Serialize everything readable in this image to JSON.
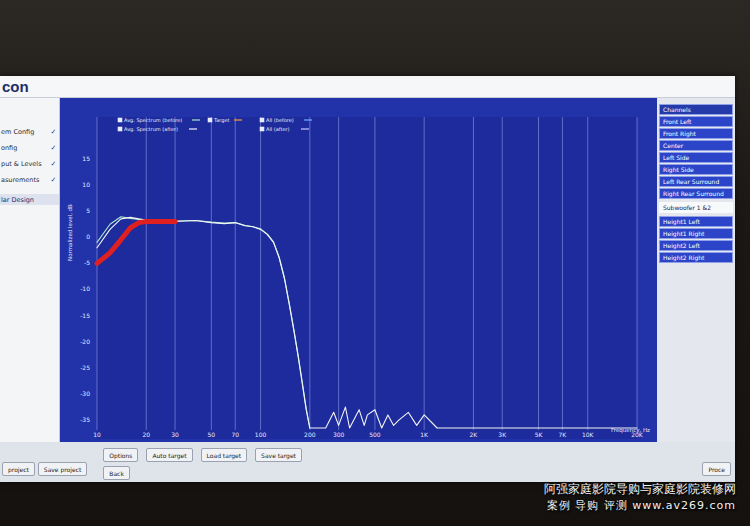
{
  "app": {
    "logo": "con"
  },
  "sidebar": {
    "check_glyph": "✓",
    "items": [
      {
        "label": "em Config",
        "done": true,
        "selected": false
      },
      {
        "label": "onfig",
        "done": true,
        "selected": false
      },
      {
        "label": "put & Levels",
        "done": true,
        "selected": false
      },
      {
        "label": "asurements",
        "done": true,
        "selected": false
      },
      {
        "label": "lar Design",
        "done": false,
        "selected": true
      }
    ]
  },
  "chart": {
    "y_axis_title": "Normalized level, dB",
    "x_axis_title": "Frequency, Hz",
    "y_ticks": [
      {
        "label": "15",
        "value": 15
      },
      {
        "label": "10",
        "value": 10
      },
      {
        "label": "5",
        "value": 5
      },
      {
        "label": "0",
        "value": 0
      },
      {
        "label": "-5",
        "value": -5
      },
      {
        "label": "-10",
        "value": -10
      },
      {
        "label": "-15",
        "value": -15
      },
      {
        "label": "-20",
        "value": -20
      },
      {
        "label": "-25",
        "value": -25
      },
      {
        "label": "-30",
        "value": -30
      },
      {
        "label": "-35",
        "value": -35
      }
    ],
    "x_ticks": [
      {
        "label": "10",
        "value": 10
      },
      {
        "label": "20",
        "value": 20
      },
      {
        "label": "30",
        "value": 30
      },
      {
        "label": "50",
        "value": 50
      },
      {
        "label": "70",
        "value": 70
      },
      {
        "label": "100",
        "value": 100
      },
      {
        "label": "200",
        "value": 200
      },
      {
        "label": "300",
        "value": 300
      },
      {
        "label": "500",
        "value": 500
      },
      {
        "label": "1K",
        "value": 1000
      },
      {
        "label": "2K",
        "value": 2000
      },
      {
        "label": "3K",
        "value": 3000
      },
      {
        "label": "5K",
        "value": 5000
      },
      {
        "label": "7K",
        "value": 7000
      },
      {
        "label": "10K",
        "value": 10000
      },
      {
        "label": "20K",
        "value": 20000
      }
    ],
    "legend": [
      {
        "label": "Avg. Spectrum (before)",
        "checked": true,
        "color": "#a8e8c8"
      },
      {
        "label": "Target",
        "checked": true,
        "color": "#ff9a3a"
      },
      {
        "label": "All (before)",
        "checked": true,
        "color": "#6fb0ff"
      },
      {
        "label": "Avg. Spectrum (after)",
        "checked": true,
        "color": "#f4f4f4"
      },
      {
        "label": "All (after)",
        "checked": true,
        "color": "#c8c8ff"
      }
    ],
    "series": [
      {
        "color": "#a8e8c8",
        "frequencies": [
          10,
          12,
          14,
          16,
          18,
          20,
          25,
          30,
          40,
          50,
          60,
          70,
          80,
          90,
          100,
          110,
          120,
          130,
          140,
          150,
          160,
          170,
          180,
          190,
          200
        ],
        "values": [
          -1,
          2.5,
          3.9,
          3.6,
          3.4,
          3.3,
          3.2,
          3.1,
          3.2,
          2.9,
          2.7,
          2.8,
          2.3,
          2.0,
          1.6,
          0.6,
          -0.9,
          -3.8,
          -7.8,
          -12.8,
          -17.8,
          -22.8,
          -27.8,
          -32.8,
          -37
        ]
      },
      {
        "color": "#f4f4f4",
        "frequencies": [
          10,
          12,
          14,
          16,
          18,
          20,
          25,
          30,
          40,
          50,
          60,
          70,
          80,
          90,
          100,
          110,
          120,
          130,
          140,
          150,
          160,
          170,
          180,
          190,
          200,
          250,
          280,
          300,
          330,
          350,
          400,
          430,
          450,
          500,
          550,
          600,
          650,
          700,
          800,
          900,
          1000,
          1200,
          1500,
          2000,
          20000
        ],
        "values": [
          -2,
          1.5,
          3.5,
          3.8,
          3.5,
          3.3,
          3.2,
          3.0,
          3.2,
          2.8,
          2.6,
          2.8,
          2.2,
          2.0,
          1.5,
          0.5,
          -1,
          -4,
          -8,
          -13,
          -18,
          -23,
          -28,
          -33,
          -37,
          -37,
          -33.5,
          -36,
          -32.5,
          -36.5,
          -33,
          -36,
          -34,
          -33,
          -36.5,
          -34,
          -36,
          -35,
          -33.5,
          -36,
          -34,
          -37,
          -37,
          -37,
          -37
        ]
      },
      {
        "color": "#e02020",
        "frequencies": [
          10,
          12,
          14,
          16,
          18,
          20,
          25,
          30
        ],
        "values": [
          -5,
          -3,
          -0.5,
          1.8,
          2.8,
          3,
          3,
          3
        ]
      }
    ]
  },
  "channels": {
    "header": "Channels",
    "items": [
      {
        "label": "Front Left",
        "selected": false
      },
      {
        "label": "Front Right",
        "selected": false
      },
      {
        "label": "Center",
        "selected": false
      },
      {
        "label": "Left Side",
        "selected": false
      },
      {
        "label": "Right Side",
        "selected": false
      },
      {
        "label": "Left Rear Surround",
        "selected": false
      },
      {
        "label": "Right Rear Surround",
        "selected": false
      },
      {
        "label": "Subwoofer 1 &2",
        "selected": true
      },
      {
        "label": "Height1 Left",
        "selected": false
      },
      {
        "label": "Height1 Right",
        "selected": false
      },
      {
        "label": "Height2 Left",
        "selected": false
      },
      {
        "label": "Height2 Right",
        "selected": false
      }
    ]
  },
  "chart_buttons": [
    "Options",
    "Auto target",
    "Load target",
    "Save target"
  ],
  "project_buttons": [
    "project",
    "Save project"
  ],
  "back_button": "Back",
  "proceed_button": "Proce",
  "watermark": {
    "line1": "阿强家庭影院导购与家庭影院装修网",
    "line2": "案例 导购 评测 www.av269.com"
  }
}
